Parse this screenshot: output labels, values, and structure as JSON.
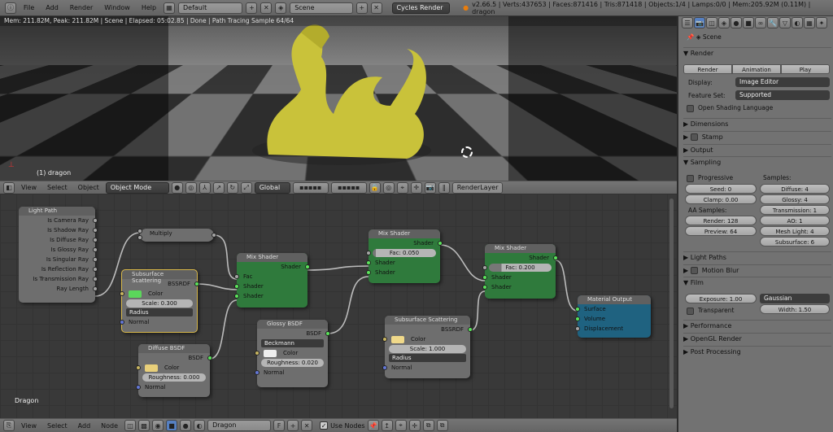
{
  "topbar": {
    "menus": [
      "File",
      "Add",
      "Render",
      "Window",
      "Help"
    ],
    "screen": "Default",
    "scene": "Scene",
    "engine": "Cycles Render",
    "stats": "v2.66.5 | Verts:437653 | Faces:871416 | Tris:871418 | Objects:1/4 | Lamps:0/0 | Mem:205.92M (0.11M) | dragon"
  },
  "viewport": {
    "status": "Mem: 211.82M, Peak: 211.82M | Scene | Elapsed: 05:02.85 | Done | Path Tracing Sample 64/64",
    "object_label": "(1) dragon"
  },
  "view3d_header": {
    "menus": [
      "View",
      "Select",
      "Object"
    ],
    "mode": "Object Mode",
    "orientation": "Global",
    "render_layer": "RenderLayer"
  },
  "node_editor": {
    "material_label": "Dragon",
    "light_path": {
      "title": "Light Path",
      "outputs": [
        "Is Camera Ray",
        "Is Shadow Ray",
        "Is Diffuse Ray",
        "Is Glossy Ray",
        "Is Singular Ray",
        "Is Reflection Ray",
        "Is Transmission Ray",
        "Ray Length"
      ]
    },
    "multiply": {
      "title": "Multiply"
    },
    "sss1": {
      "title": "Subsurface Scattering",
      "output": "BSSRDF",
      "color": "Color",
      "scale": "Scale: 0.300",
      "falloff": "Radius",
      "normal": "Normal",
      "swatch": "#5bd65b"
    },
    "mix1": {
      "title": "Mix Shader",
      "output": "Shader",
      "fac": "Fac",
      "in1": "Shader",
      "in2": "Shader"
    },
    "diffuse": {
      "title": "Diffuse BSDF",
      "output": "BSDF",
      "color": "Color",
      "roughness": "Roughness: 0.000",
      "normal": "Normal",
      "swatch": "#e8cf7a"
    },
    "glossy": {
      "title": "Glossy BSDF",
      "output": "BSDF",
      "distribution": "Beckmann",
      "color": "Color",
      "roughness": "Roughness: 0.020",
      "normal": "Normal",
      "swatch": "#eeeeee"
    },
    "mix2": {
      "title": "Mix Shader",
      "output": "Shader",
      "fac": "Fac: 0.050",
      "fac_value": 0.05,
      "in1": "Shader",
      "in2": "Shader"
    },
    "sss2": {
      "title": "Subsurface Scattering",
      "output": "BSSRDF",
      "color": "Color",
      "scale": "Scale: 1.000",
      "falloff": "Radius",
      "normal": "Normal",
      "swatch": "#f0d98a"
    },
    "mix3": {
      "title": "Mix Shader",
      "output": "Shader",
      "fac": "Fac: 0.200",
      "fac_value": 0.2,
      "in1": "Shader",
      "in2": "Shader"
    },
    "output": {
      "title": "Material Output",
      "inputs": [
        "Surface",
        "Volume",
        "Displacement"
      ]
    }
  },
  "node_header": {
    "menus": [
      "View",
      "Select",
      "Add",
      "Node"
    ],
    "material": "Dragon",
    "fake_user": "F",
    "use_nodes": "Use Nodes"
  },
  "properties": {
    "scene": "Scene",
    "render": {
      "title": "Render",
      "render_btn": "Render",
      "animation_btn": "Animation",
      "play_btn": "Play",
      "display_label": "Display:",
      "display": "Image Editor",
      "feature_label": "Feature Set:",
      "feature": "Supported",
      "osl": "Open Shading Language"
    },
    "collapsed1": [
      "Dimensions",
      "Stamp",
      "Output"
    ],
    "sampling": {
      "title": "Sampling",
      "progressive": "Progressive",
      "samples_label": "Samples:",
      "seed": "Seed: 0",
      "clamp": "Clamp: 0.00",
      "aa_label": "AA Samples:",
      "render": "Render: 128",
      "preview": "Preview: 64",
      "diffuse": "Diffuse: 4",
      "glossy": "Glossy: 4",
      "transmission": "Transmission: 1",
      "ao": "AO: 1",
      "mesh_light": "Mesh Light: 4",
      "subsurface": "Subsurface: 6"
    },
    "light_paths": "Light Paths",
    "motion_blur": "Motion Blur",
    "film": {
      "title": "Film",
      "exposure": "Exposure: 1.00",
      "filter": "Gaussian",
      "transparent": "Transparent",
      "width": "Width: 1.50"
    },
    "collapsed2": [
      "Performance",
      "OpenGL Render",
      "Post Processing"
    ]
  },
  "colors": {
    "shader_node": "#2f7a3c",
    "output_node": "#1f6280",
    "dragon": "#c9c23a"
  }
}
